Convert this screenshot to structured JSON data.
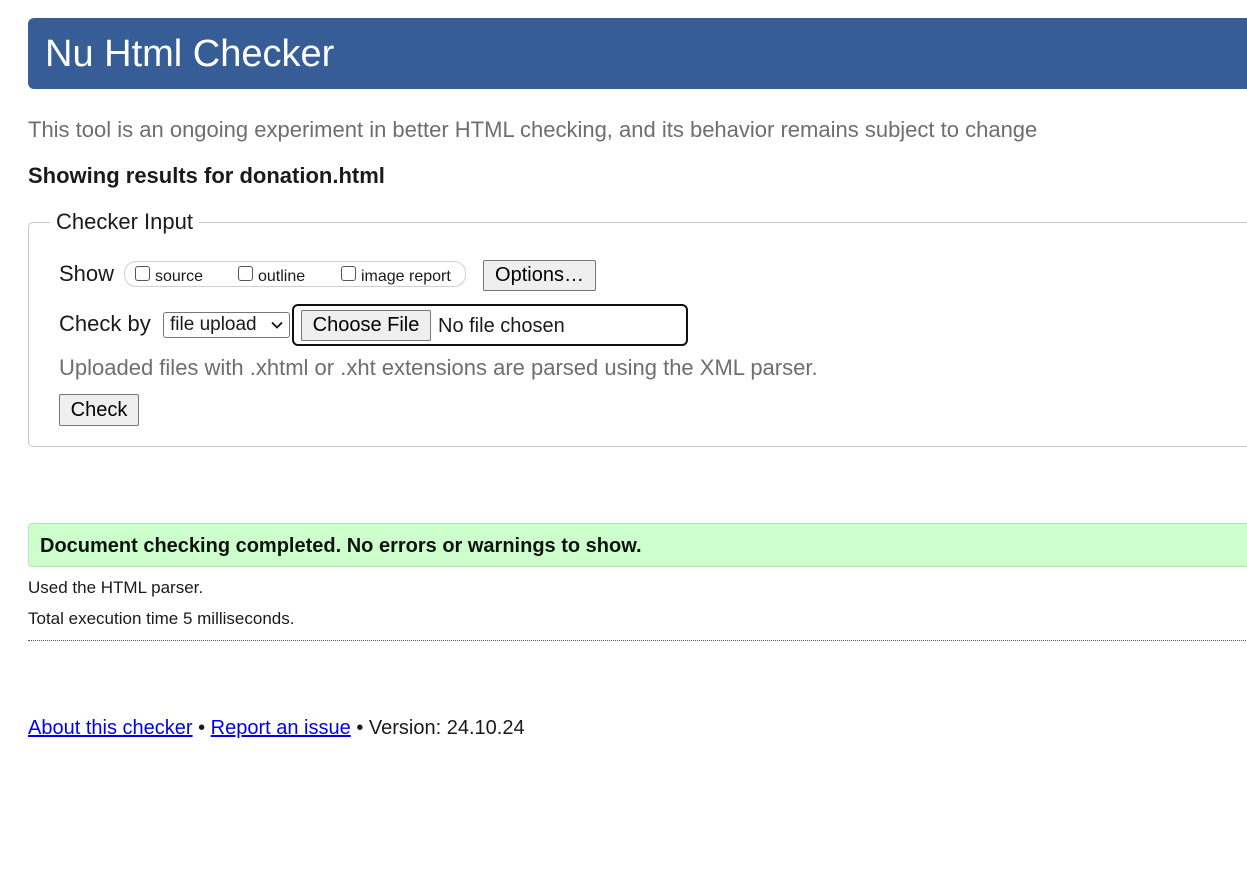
{
  "header": {
    "title": "Nu Html Checker"
  },
  "subtitle": "This tool is an ongoing experiment in better HTML checking, and its behavior remains subject to change",
  "results_for": "Showing results for donation.html",
  "checker_input": {
    "legend": "Checker Input",
    "show_label": "Show",
    "checkboxes": [
      {
        "label": "source",
        "checked": false
      },
      {
        "label": "outline",
        "checked": false
      },
      {
        "label": "image report",
        "checked": false
      }
    ],
    "options_button": "Options…",
    "check_by_label": "Check by",
    "check_by_selected": "file upload",
    "choose_file_button": "Choose File",
    "file_status": "No file chosen",
    "xml_note": "Uploaded files with .xhtml or .xht extensions are parsed using the XML parser.",
    "check_button": "Check"
  },
  "result": {
    "message": "Document checking completed. No errors or warnings to show.",
    "parser_note": "Used the HTML parser.",
    "execution_time": "Total execution time 5 milliseconds."
  },
  "footer": {
    "about_link": "About this checker",
    "separator": "•",
    "report_link": "Report an issue",
    "version": "Version: 24.10.24"
  },
  "colors": {
    "header_bg": "#365d95",
    "success_bg": "#ccffcc",
    "link": "#0000ee"
  }
}
